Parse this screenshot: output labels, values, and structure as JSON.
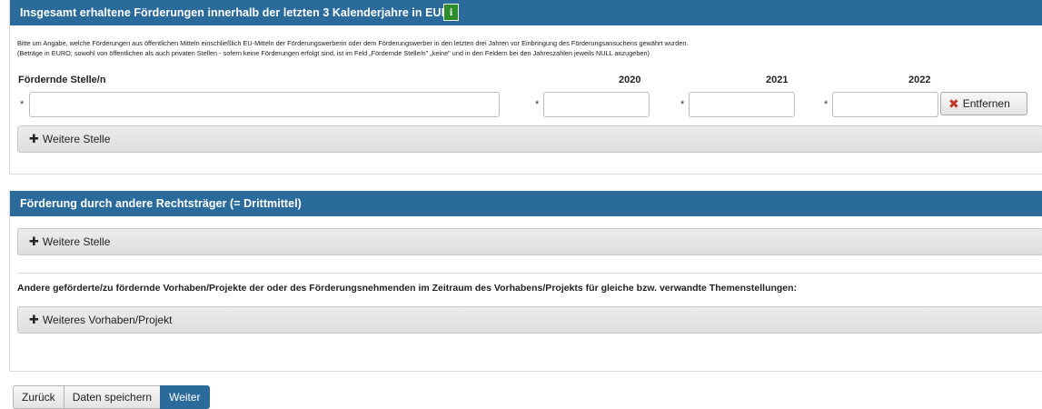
{
  "section1": {
    "title": "Insgesamt erhaltene Förderungen innerhalb der letzten 3 Kalenderjahre in EURO",
    "info_icon_glyph": "i",
    "description_line1": "Bitte um Angabe, welche Förderungen aus öffentlichen Mitteln einschließlich EU-Mitteln der Förderungswerberin oder dem Förderungswerber in den letzten drei Jahren vor Einbringung des Förderungsansuchens gewährt wurden.",
    "description_line2": "(Beträge in EURO; sowohl von öffentlichen als auch privaten Stellen - sofern keine Förderungen erfolgt sind, ist im Feld „Fördernde Stelle/n\" „keine\" und in den Feldern bei den Jahreszahlen jeweils NULL anzugeben)",
    "columns": {
      "stelle": "Fördernde Stelle/n",
      "year1": "2020",
      "year2": "2021",
      "year3": "2022"
    },
    "required_marker": "*",
    "row": {
      "stelle_value": "",
      "year1_value": "",
      "year2_value": "",
      "year3_value": ""
    },
    "remove_label": "Entfernen",
    "add_label": "Weitere Stelle"
  },
  "section2": {
    "title": "Förderung durch andere Rechtsträger (= Drittmittel)",
    "add_label": "Weitere Stelle",
    "projects_label": "Andere geförderte/zu fördernde Vorhaben/Projekte der oder des Förderungsnehmenden im Zeitraum des Vorhabens/Projekts für gleiche bzw. verwandte Themenstellungen:",
    "add_project_label": "Weiteres Vorhaben/Projekt"
  },
  "footer": {
    "back_label": "Zurück",
    "save_label": "Daten speichern",
    "next_label": "Weiter"
  },
  "colors": {
    "header_blue": "#2a6b9c",
    "info_green": "#2f8d2c",
    "remove_red": "#c0392b"
  }
}
